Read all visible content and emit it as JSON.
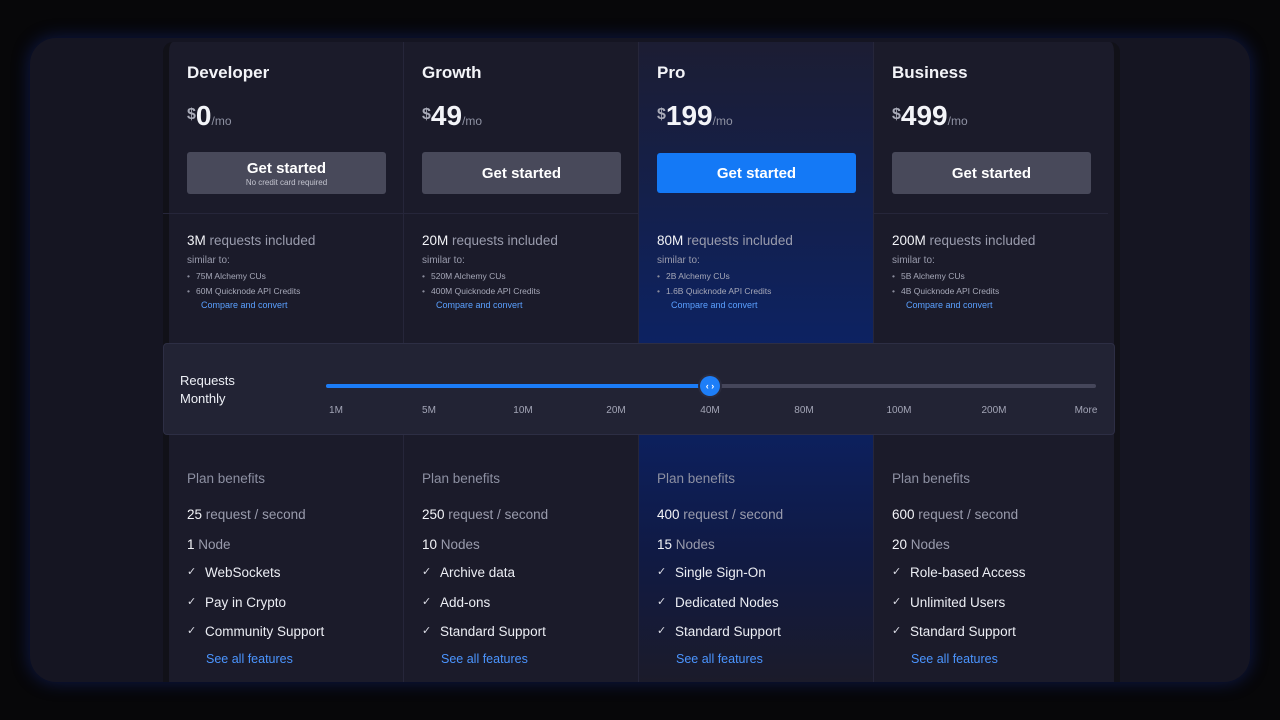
{
  "plans": [
    {
      "name": "Developer",
      "currency": "$",
      "amount": "0",
      "period": "/mo",
      "cta": "Get started",
      "cta_sub": "No credit card required",
      "requests_value": "3M",
      "requests_suffix": " requests included",
      "similar_label": "similar to:",
      "similar": [
        "75M Alchemy CUs",
        "60M Quicknode API Credits"
      ],
      "compare_link": "Compare and convert",
      "benefits_title": "Plan benefits",
      "rps_value": "25",
      "rps_suffix": " request / second",
      "nodes_value": "1",
      "nodes_suffix": " Node",
      "features": [
        "WebSockets",
        "Pay in Crypto",
        "Community Support"
      ],
      "see_all": "See all features"
    },
    {
      "name": "Growth",
      "currency": "$",
      "amount": "49",
      "period": "/mo",
      "cta": "Get started",
      "requests_value": "20M",
      "requests_suffix": " requests included",
      "similar_label": "similar to:",
      "similar": [
        "520M Alchemy CUs",
        "400M Quicknode API Credits"
      ],
      "compare_link": "Compare and convert",
      "benefits_title": "Plan benefits",
      "rps_value": "250",
      "rps_suffix": " request / second",
      "nodes_value": "10",
      "nodes_suffix": " Nodes",
      "features": [
        "Archive data",
        "Add-ons",
        "Standard Support"
      ],
      "see_all": "See all features"
    },
    {
      "name": "Pro",
      "currency": "$",
      "amount": "199",
      "period": "/mo",
      "cta": "Get started",
      "requests_value": "80M",
      "requests_suffix": " requests included",
      "similar_label": "similar to:",
      "similar": [
        "2B Alchemy CUs",
        "1.6B Quicknode API Credits"
      ],
      "compare_link": "Compare and convert",
      "benefits_title": "Plan benefits",
      "rps_value": "400",
      "rps_suffix": " request / second",
      "nodes_value": "15",
      "nodes_suffix": " Nodes",
      "features": [
        "Single Sign-On",
        "Dedicated Nodes",
        "Standard Support"
      ],
      "see_all": "See all features"
    },
    {
      "name": "Business",
      "currency": "$",
      "amount": "499",
      "period": "/mo",
      "cta": "Get started",
      "requests_value": "200M",
      "requests_suffix": " requests included",
      "similar_label": "similar to:",
      "similar": [
        "5B Alchemy CUs",
        "4B Quicknode API Credits"
      ],
      "compare_link": "Compare and convert",
      "benefits_title": "Plan benefits",
      "rps_value": "600",
      "rps_suffix": " request / second",
      "nodes_value": "20",
      "nodes_suffix": " Nodes",
      "features": [
        "Role-based Access",
        "Unlimited Users",
        "Standard Support"
      ],
      "see_all": "See all features"
    }
  ],
  "slider": {
    "label_line1": "Requests",
    "label_line2": "Monthly",
    "ticks": [
      "1M",
      "5M",
      "10M",
      "20M",
      "40M",
      "80M",
      "100M",
      "200M",
      "More"
    ],
    "selected_index": 4,
    "selected_value": "40M",
    "knob_glyph": "‹ ›"
  },
  "colors": {
    "accent": "#1479f6",
    "link": "#4b95ff",
    "panel": "#1b1b2a",
    "frame": "#151522"
  },
  "icons": {
    "feature_check": "check-icon",
    "slider_knob": "slider-handle-arrows-icon"
  }
}
